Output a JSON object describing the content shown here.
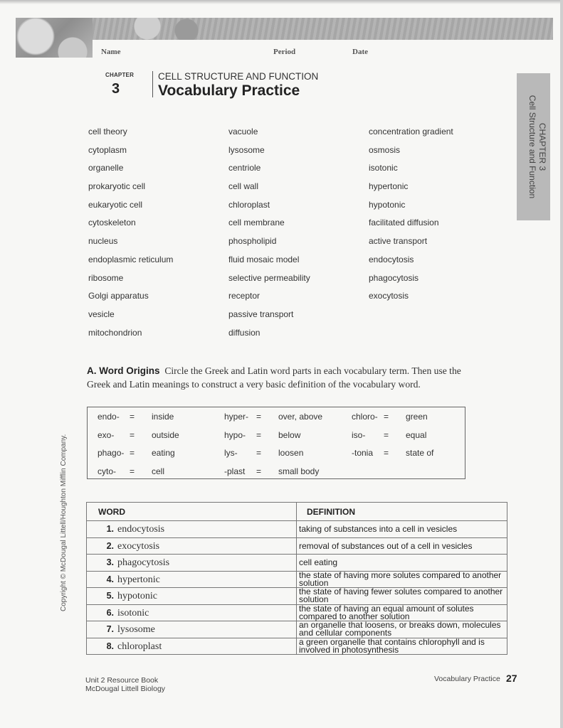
{
  "header": {
    "name_label": "Name",
    "period_label": "Period",
    "date_label": "Date",
    "chapter_label": "CHAPTER",
    "chapter_number": "3",
    "subtitle": "CELL STRUCTURE AND FUNCTION",
    "title": "Vocabulary Practice"
  },
  "side_tab": {
    "line1": "CHAPTER 3",
    "line2": "Cell Structure and Function"
  },
  "vocabulary": {
    "column1": [
      "cell theory",
      "cytoplasm",
      "organelle",
      "prokaryotic cell",
      "eukaryotic cell",
      "cytoskeleton",
      "nucleus",
      "endoplasmic reticulum",
      "ribosome",
      "Golgi apparatus",
      "vesicle",
      "mitochondrion"
    ],
    "column2": [
      "vacuole",
      "lysosome",
      "centriole",
      "cell wall",
      "chloroplast",
      "cell membrane",
      "phospholipid",
      "fluid mosaic model",
      "selective permeability",
      "receptor",
      "passive transport",
      "diffusion"
    ],
    "column3": [
      "concentration gradient",
      "osmosis",
      "isotonic",
      "hypertonic",
      "hypotonic",
      "facilitated diffusion",
      "active transport",
      "endocytosis",
      "phagocytosis",
      "exocytosis"
    ]
  },
  "section_a": {
    "heading": "A. Word Origins",
    "instructions": "Circle the Greek and Latin word parts in each vocabulary term. Then use the Greek and Latin meanings to construct a very basic definition of the vocabulary word."
  },
  "word_origins": [
    {
      "part": "endo-",
      "eq": "=",
      "meaning": "inside"
    },
    {
      "part": "exo-",
      "eq": "=",
      "meaning": "outside"
    },
    {
      "part": "phago-",
      "eq": "=",
      "meaning": "eating"
    },
    {
      "part": "cyto-",
      "eq": "=",
      "meaning": "cell"
    },
    {
      "part": "hyper-",
      "eq": "=",
      "meaning": "over, above"
    },
    {
      "part": "hypo-",
      "eq": "=",
      "meaning": "below"
    },
    {
      "part": "lys-",
      "eq": "=",
      "meaning": "loosen"
    },
    {
      "part": "-plast",
      "eq": "=",
      "meaning": "small body"
    },
    {
      "part": "chloro-",
      "eq": "=",
      "meaning": "green"
    },
    {
      "part": "iso-",
      "eq": "=",
      "meaning": "equal"
    },
    {
      "part": "-tonia",
      "eq": "=",
      "meaning": "state of"
    }
  ],
  "definitions_table": {
    "headers": {
      "word": "WORD",
      "definition": "DEFINITION"
    },
    "rows": [
      {
        "num": "1.",
        "word": "endocytosis",
        "definition": "taking of substances into a cell in vesicles"
      },
      {
        "num": "2.",
        "word": "exocytosis",
        "definition": "removal of substances out of a cell in vesicles"
      },
      {
        "num": "3.",
        "word": "phagocytosis",
        "definition": "cell eating"
      },
      {
        "num": "4.",
        "word": "hypertonic",
        "definition": "the state of having more solutes compared to another solution"
      },
      {
        "num": "5.",
        "word": "hypotonic",
        "definition": "the state of having fewer solutes compared to another solution"
      },
      {
        "num": "6.",
        "word": "isotonic",
        "definition": "the state of having an equal amount of solutes compared to another solution"
      },
      {
        "num": "7.",
        "word": "lysosome",
        "definition": "an organelle that loosens, or breaks down, molecules and cellular components"
      },
      {
        "num": "8.",
        "word": "chloroplast",
        "definition": "a green organelle that contains chlorophyll and is involved in photosynthesis"
      }
    ]
  },
  "copyright": "Copyright © McDougal Littell/Houghton Mifflin Company.",
  "footer": {
    "book_line1": "Unit 2 Resource Book",
    "book_line2": "McDougal Littell Biology",
    "section": "Vocabulary Practice",
    "page": "27"
  }
}
